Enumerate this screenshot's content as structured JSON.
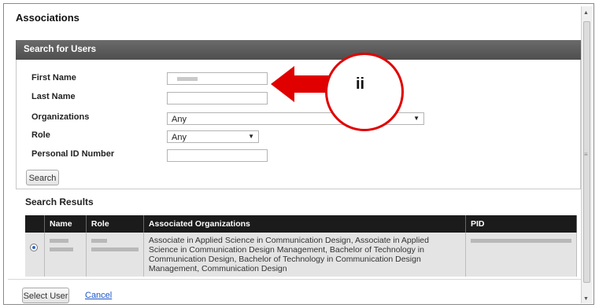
{
  "dialog": {
    "title": "Associations"
  },
  "search_panel": {
    "header": "Search for Users",
    "first_name_label": "First Name",
    "last_name_label": "Last Name",
    "organizations_label": "Organizations",
    "organizations_value": "Any",
    "role_label": "Role",
    "role_value": "Any",
    "personal_id_label": "Personal ID Number",
    "search_button": "Search"
  },
  "results": {
    "title": "Search Results",
    "columns": [
      "",
      "Name",
      "Role",
      "Associated Organizations",
      "PID"
    ],
    "rows": [
      {
        "selected": true,
        "associated_organizations": "Associate in Applied Science in Communication Design, Associate in Applied Science in Communication Design Management, Bachelor of Technology in Communication Design, Bachelor of Technology in Communication Design Management, Communication Design"
      }
    ]
  },
  "footer": {
    "select_button": "Select User",
    "cancel_link": "Cancel"
  },
  "annotation": {
    "label": "ii",
    "color": "#e00000"
  }
}
